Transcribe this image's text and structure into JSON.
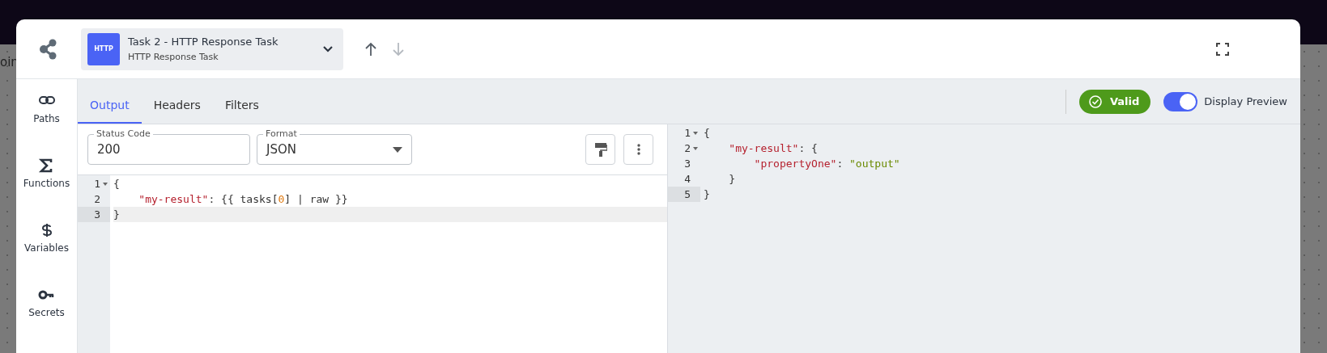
{
  "background": {
    "page_fragment": "oin"
  },
  "task": {
    "badge": "HTTP",
    "title": "Task 2 - HTTP Response Task",
    "subtitle": "HTTP Response Task",
    "move_up_disabled": false,
    "move_down_disabled": true
  },
  "sidebar": {
    "items": [
      {
        "label": "Paths"
      },
      {
        "label": "Functions"
      },
      {
        "label": "Variables"
      },
      {
        "label": "Secrets"
      }
    ]
  },
  "tabs": [
    {
      "label": "Output",
      "selected": true
    },
    {
      "label": "Headers",
      "selected": false
    },
    {
      "label": "Filters",
      "selected": false
    }
  ],
  "status": {
    "label": "Valid",
    "valid": true
  },
  "preview_toggle": {
    "label": "Display Preview",
    "on": true
  },
  "fields": {
    "status_code": {
      "label": "Status Code",
      "value": "200"
    },
    "format": {
      "label": "Format",
      "value": "JSON"
    }
  },
  "editor": {
    "lines": [
      {
        "number": "1",
        "foldable": true,
        "active": false,
        "tokens": [
          {
            "kind": "punct",
            "text": "{"
          }
        ]
      },
      {
        "number": "2",
        "foldable": false,
        "active": false,
        "tokens": [
          {
            "kind": "key",
            "text": "    \"my-result\""
          },
          {
            "kind": "plain",
            "text": ": {{ tasks["
          },
          {
            "kind": "number",
            "text": "0"
          },
          {
            "kind": "plain",
            "text": "] | raw }}"
          }
        ]
      },
      {
        "number": "3",
        "foldable": false,
        "active": true,
        "tokens": [
          {
            "kind": "punct",
            "text": "}"
          }
        ]
      }
    ]
  },
  "preview": {
    "lines": [
      {
        "number": "1",
        "foldable": true,
        "active": false,
        "tokens": [
          {
            "kind": "punct",
            "text": "{"
          }
        ]
      },
      {
        "number": "2",
        "foldable": true,
        "active": false,
        "tokens": [
          {
            "kind": "key",
            "text": "    \"my-result\""
          },
          {
            "kind": "plain",
            "text": ": {"
          }
        ]
      },
      {
        "number": "3",
        "foldable": false,
        "active": false,
        "tokens": [
          {
            "kind": "key",
            "text": "        \"propertyOne\""
          },
          {
            "kind": "plain",
            "text": ": "
          },
          {
            "kind": "string",
            "text": "\"output\""
          }
        ]
      },
      {
        "number": "4",
        "foldable": false,
        "active": false,
        "tokens": [
          {
            "kind": "plain",
            "text": "    }"
          }
        ]
      },
      {
        "number": "5",
        "foldable": false,
        "active": true,
        "tokens": [
          {
            "kind": "punct",
            "text": "}"
          }
        ]
      }
    ]
  }
}
